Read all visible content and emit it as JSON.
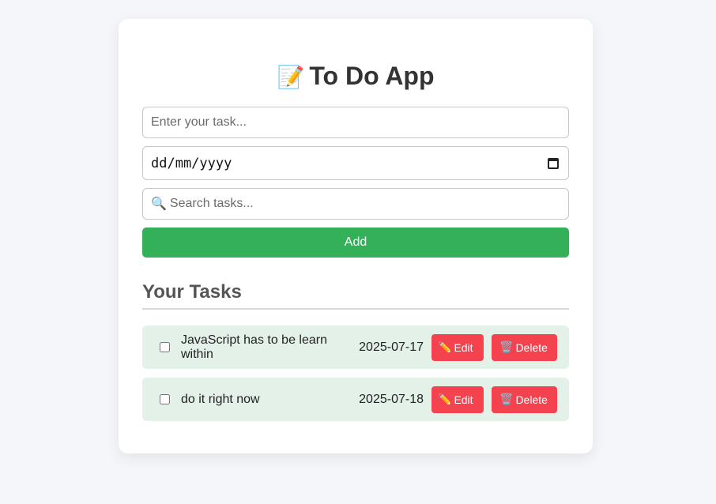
{
  "app": {
    "title": "To Do App",
    "title_icon": "📝"
  },
  "form": {
    "task_placeholder": "Enter your task...",
    "task_value": "",
    "date_placeholder": "dd/mm/yyyy",
    "search_placeholder": "Search tasks...",
    "search_icon": "🔍",
    "add_label": "Add"
  },
  "tasks_section": {
    "title": "Your Tasks"
  },
  "tasks": [
    {
      "text": "JavaScript has to be learn within",
      "date": "2025-07-17",
      "done": false,
      "edit_icon": "✏️",
      "edit_label": "Edit",
      "delete_icon": "🗑️",
      "delete_label": "Delete"
    },
    {
      "text": "do it right now",
      "date": "2025-07-18",
      "done": false,
      "edit_icon": "✏️",
      "edit_label": "Edit",
      "delete_icon": "🗑️",
      "delete_label": "Delete"
    }
  ],
  "colors": {
    "add_button": "#34b058",
    "action_button": "#f5424f",
    "task_row_bg": "#e4f1e9",
    "page_bg": "#f4f6fa"
  }
}
